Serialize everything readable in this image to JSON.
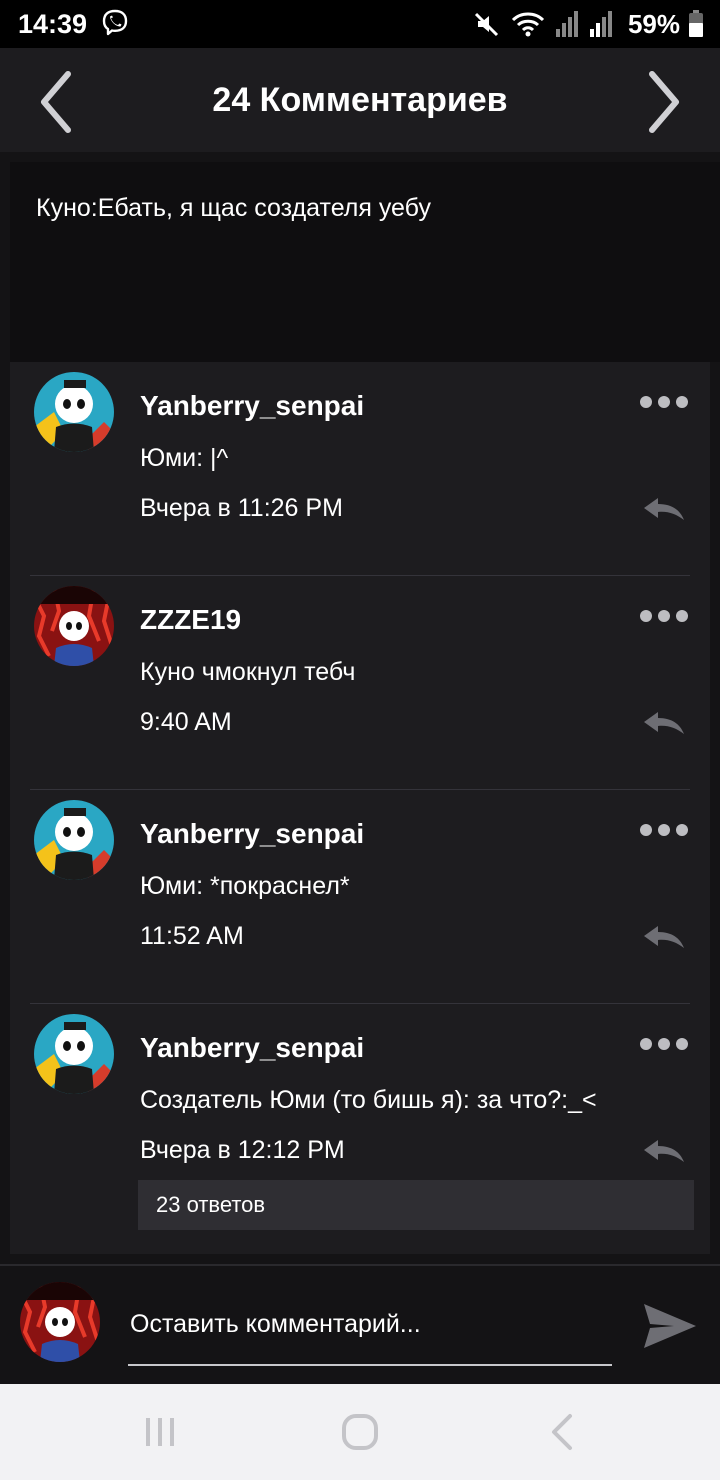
{
  "status_bar": {
    "time": "14:39",
    "battery": "59%",
    "icons": [
      "viber-icon",
      "mute-icon",
      "wifi-icon",
      "signal-icon",
      "signal-icon",
      "battery-icon"
    ]
  },
  "header": {
    "title": "24 Комментариев",
    "prev_icon": "chevron-left-icon",
    "next_icon": "chevron-right-icon"
  },
  "post": {
    "text": "Куно:Ебать, я щас создателя уебу"
  },
  "comments": [
    {
      "username": "Yanberry_senpai",
      "text": "Юми: |^",
      "time": "Вчера в 11:26 PM",
      "avatar": "blue-skull"
    },
    {
      "username": "ZZZE19",
      "text": "Куно чмокнул тебч",
      "time": "9:40 AM",
      "avatar": "red-skull"
    },
    {
      "username": "Yanberry_senpai",
      "text": "Юми: *покраснел*",
      "time": "11:52 AM",
      "avatar": "blue-skull"
    },
    {
      "username": "Yanberry_senpai",
      "text": "Создатель Юми (то бишь я): за что?:_<",
      "time": "Вчера в 12:12 PM",
      "avatar": "blue-skull"
    }
  ],
  "replies_label": "23 ответов",
  "composer": {
    "placeholder": "Оставить комментарий..."
  },
  "colors": {
    "background": "#141315",
    "panel": "#1d1c1f",
    "post_bg": "#0f0e10",
    "accent_gray": "#bdbdc1"
  }
}
